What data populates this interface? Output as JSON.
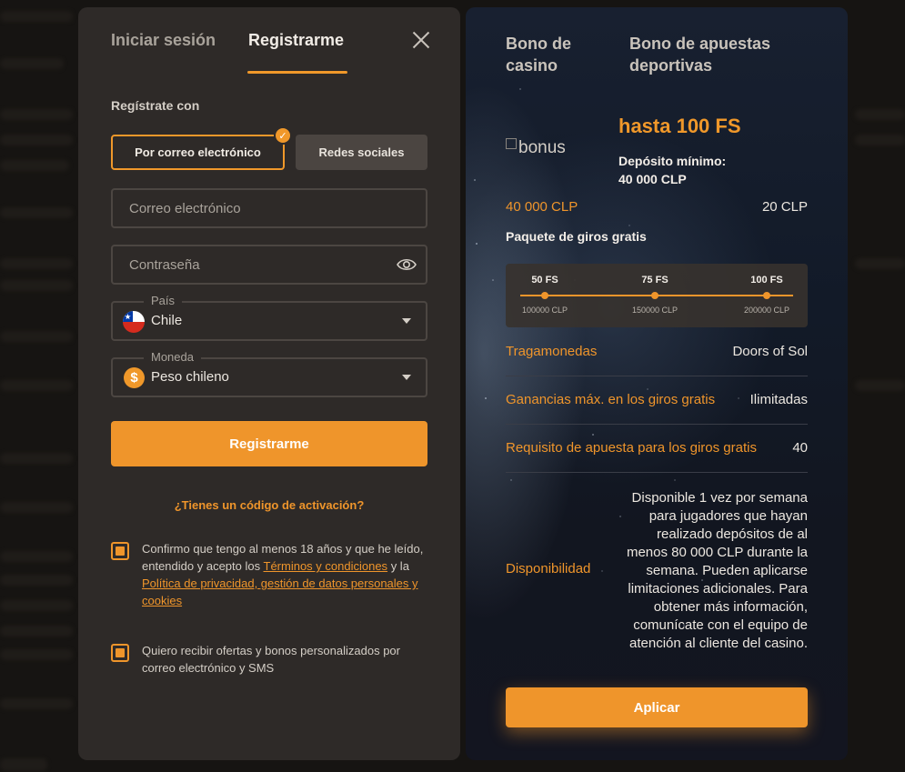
{
  "left": {
    "tabs": {
      "login": "Iniciar sesión",
      "register": "Registrarme"
    },
    "register_with": "Regístrate con",
    "methods": {
      "email": "Por correo electrónico",
      "social": "Redes sociales"
    },
    "email_placeholder": "Correo electrónico",
    "password_placeholder": "Contraseña",
    "country": {
      "label": "País",
      "value": "Chile"
    },
    "currency": {
      "label": "Moneda",
      "value": "Peso chileno",
      "symbol": "$"
    },
    "submit": "Registrarme",
    "promo_link": "¿Tienes un código de activación?",
    "consent1": {
      "text_a": "Confirmo que tengo al menos 18 años y que he leído, entendido y acepto los",
      "terms_link": "Términos y condiciones",
      "text_b": "y la",
      "privacy_link": "Política de privacidad, gestión de datos personales y cookies"
    },
    "consent2": "Quiero recibir ofertas y bonos personalizados por correo electrónico y SMS"
  },
  "right": {
    "tabs": {
      "casino": "Bono de casino",
      "sports": "Bono de apuestas deportivas"
    },
    "image_alt": "bonus",
    "title": "hasta 100 FS",
    "min_deposit_label": "Depósito mínimo:",
    "min_deposit_value": "40 000 CLP",
    "row_amount_left": "40 000 CLP",
    "row_amount_right": "20 CLP",
    "package_label": "Paquete de giros gratis",
    "package": [
      {
        "fs": "50 FS",
        "clp": "100000 CLP"
      },
      {
        "fs": "75 FS",
        "clp": "150000 CLP"
      },
      {
        "fs": "100 FS",
        "clp": "200000 CLP"
      }
    ],
    "rows": [
      {
        "label": "Tragamonedas",
        "value": "Doors of Sol"
      },
      {
        "label": "Ganancias máx. en los giros gratis",
        "value": "Ilimitadas"
      },
      {
        "label": "Requisito de apuesta para los giros gratis",
        "value": "40"
      }
    ],
    "availability_label": "Disponibilidad",
    "availability_text": "Disponible 1 vez por semana para jugadores que hayan realizado depósitos de al menos 80 000 CLP durante la semana. Pueden aplicarse limitaciones adicionales. Para obtener más información, comunícate con el equipo de atención al cliente del casino.",
    "apply": "Aplicar"
  },
  "colors": {
    "accent": "#ef952b",
    "panel": "#2e2a28"
  }
}
